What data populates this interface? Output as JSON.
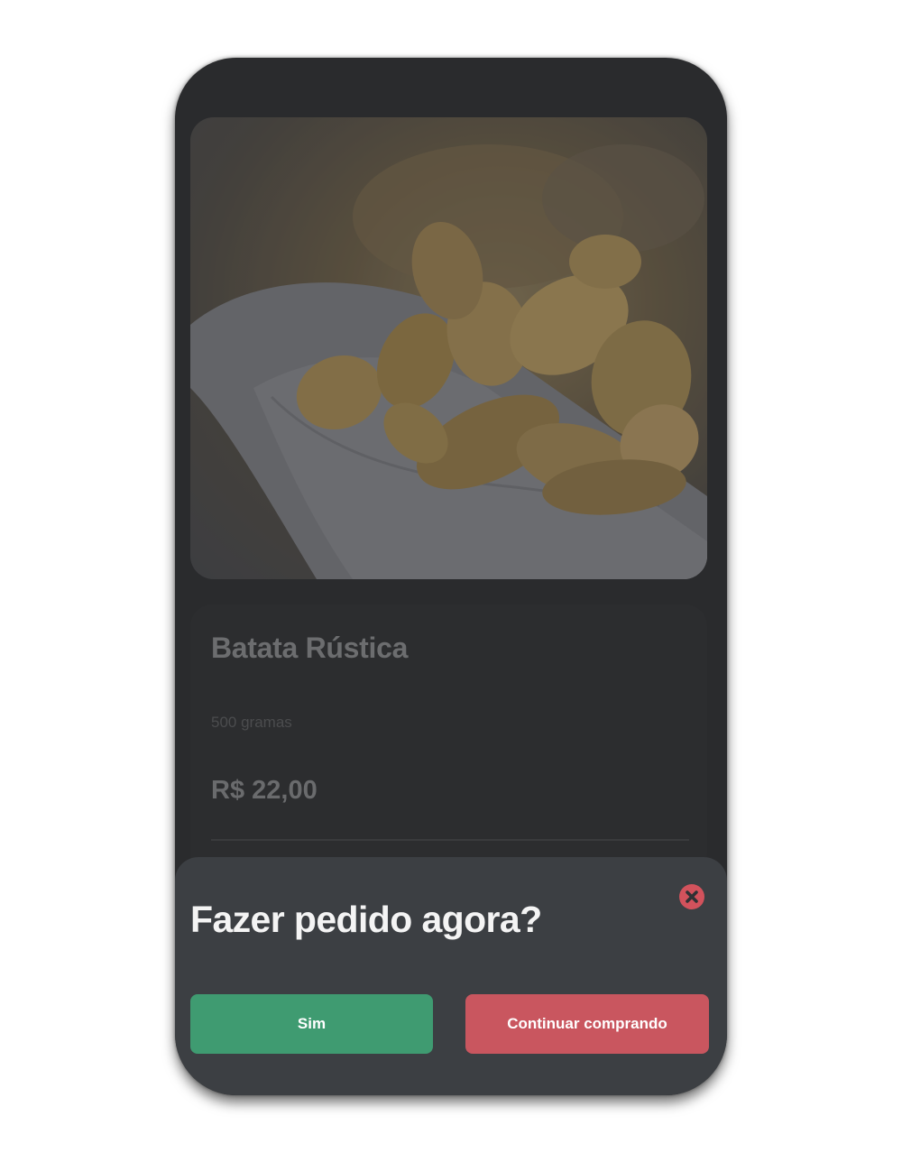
{
  "product": {
    "image_icon": "potato-wedges-photo",
    "name": "Batata Rústica",
    "weight": "500 gramas",
    "price": "R$ 22,00"
  },
  "order_modal": {
    "title": "Fazer pedido agora?",
    "close_icon": "close-icon",
    "yes_label": "Sim",
    "continue_label": "Continuar comprando"
  },
  "colors": {
    "phone_background": "#2a2b2d",
    "modal_background": "#3c3f43",
    "yes_button": "#3f9b71",
    "continue_button": "#c9565f",
    "close_button": "#d2525c"
  }
}
